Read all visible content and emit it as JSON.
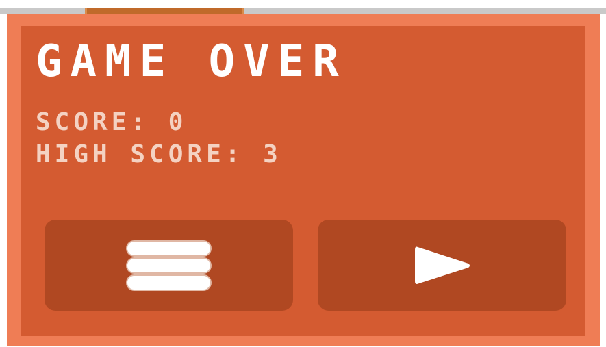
{
  "game_over": {
    "title": "GAME OVER",
    "score_text": "SCORE: 0",
    "high_score_text": "HIGH SCORE: 3",
    "score": 0,
    "high_score": 3
  },
  "buttons": {
    "menu_icon": "menu-icon",
    "play_icon": "play-icon"
  },
  "colors": {
    "panel": "#d45b31",
    "frame": "#ef7d55",
    "button": "#b04822",
    "text": "#ffffff",
    "stat_text": "#f4d2c2"
  }
}
